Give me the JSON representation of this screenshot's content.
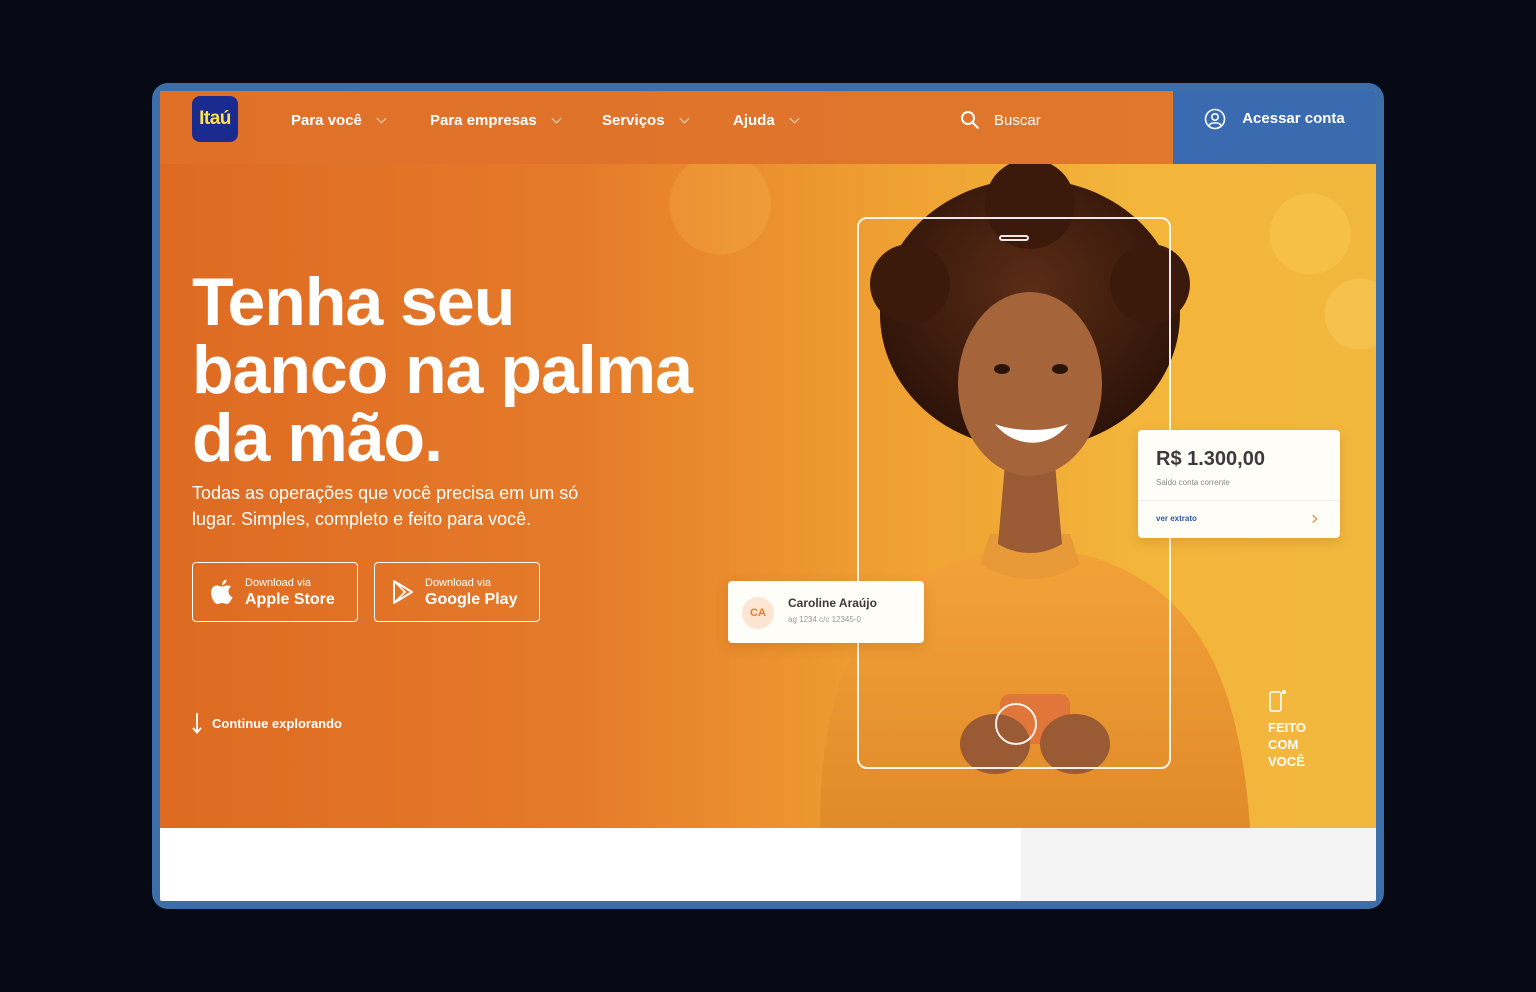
{
  "brand": {
    "logo_text": "Itaú",
    "primary_color": "#e07028",
    "navy": "#1a2b8f",
    "account_blue": "#3a6bb0"
  },
  "nav": {
    "items": [
      {
        "label": "Para você"
      },
      {
        "label": "Para empresas"
      },
      {
        "label": "Serviços"
      },
      {
        "label": "Ajuda"
      }
    ],
    "search_label": "Buscar",
    "account_label": "Acessar conta"
  },
  "hero": {
    "headline": [
      "Tenha seu",
      "banco na palma",
      "da mão."
    ],
    "subtitle": [
      "Todas as operações que você precisa em um só",
      "lugar. Simples, completo e feito para você."
    ],
    "stores": [
      {
        "small": "Download via",
        "big": "Apple Store"
      },
      {
        "small": "Download via",
        "big": "Google Play"
      }
    ],
    "explore_label": "Continue explorando"
  },
  "balance_card": {
    "amount": "R$ 1.300,00",
    "label": "Saldo conta corrente",
    "link": "ver extrato"
  },
  "user_card": {
    "initials": "CA",
    "name": "Caroline Araújo",
    "account": "ag 1234  c/c 12345-0"
  },
  "tagline": [
    "FEITO",
    "COM",
    "VOCÊ"
  ]
}
